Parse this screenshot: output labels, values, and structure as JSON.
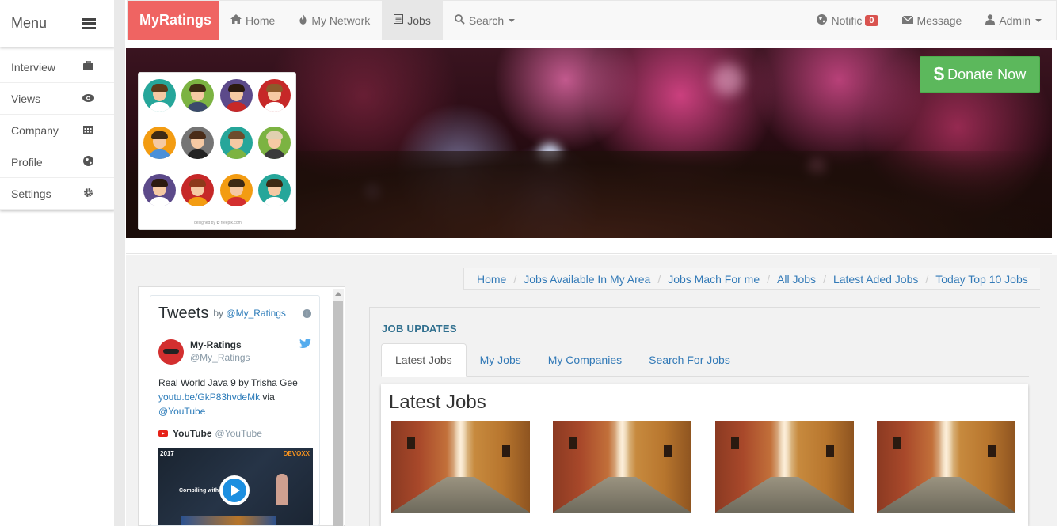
{
  "sidebar": {
    "title": "Menu",
    "items": [
      {
        "label": "Interview",
        "icon": "briefcase-icon"
      },
      {
        "label": "Views",
        "icon": "eye-icon"
      },
      {
        "label": "Company",
        "icon": "calendar-icon"
      },
      {
        "label": "Profile",
        "icon": "globe-icon"
      },
      {
        "label": "Settings",
        "icon": "gear-icon"
      }
    ]
  },
  "navbar": {
    "brand": "MyRatings",
    "items": [
      {
        "label": "Home",
        "icon": "home-icon"
      },
      {
        "label": "My Network",
        "icon": "fire-icon"
      },
      {
        "label": "Jobs",
        "icon": "list-icon",
        "active": true
      },
      {
        "label": "Search",
        "icon": "search-icon"
      }
    ],
    "right": {
      "notifications_label": "Notific",
      "notifications_count": "0",
      "message_label": "Message",
      "admin_label": "Admin"
    }
  },
  "banner": {
    "donate_label": "Donate Now",
    "donate_symbol": "$",
    "avatars_credit": "designed by ✿ freepik.com"
  },
  "breadcrumb": [
    "Home",
    "Jobs Available In My Area",
    "Jobs Mach For me",
    "All Jobs",
    "Latest Aded Jobs",
    "Today Top 10 Jobs"
  ],
  "twitter": {
    "title": "Tweets",
    "by": "by",
    "handle": "@My_Ratings",
    "user_name": "My-Ratings",
    "user_handle": "@My_Ratings",
    "tweet_text": "Real World Java 9 by Trisha Gee",
    "tweet_link": "youtu.be/GkP83hvdeMk",
    "tweet_via": "via",
    "tweet_mention": "@YouTube",
    "yt_name": "YouTube",
    "yt_handle": "@YouTube",
    "video_year": "2017",
    "video_brand": "DEVOXX",
    "video_caption": "Compiling with"
  },
  "jobs": {
    "section_title": "JOB UPDATES",
    "tabs": [
      "Latest Jobs",
      "My Jobs",
      "My Companies",
      "Search For Jobs"
    ],
    "active_tab": "Latest Jobs",
    "box_title": "Latest Jobs"
  },
  "colors": {
    "brand": "#ef6462",
    "donate": "#5cb85c",
    "link": "#337ab7",
    "badge": "#d9534f"
  }
}
